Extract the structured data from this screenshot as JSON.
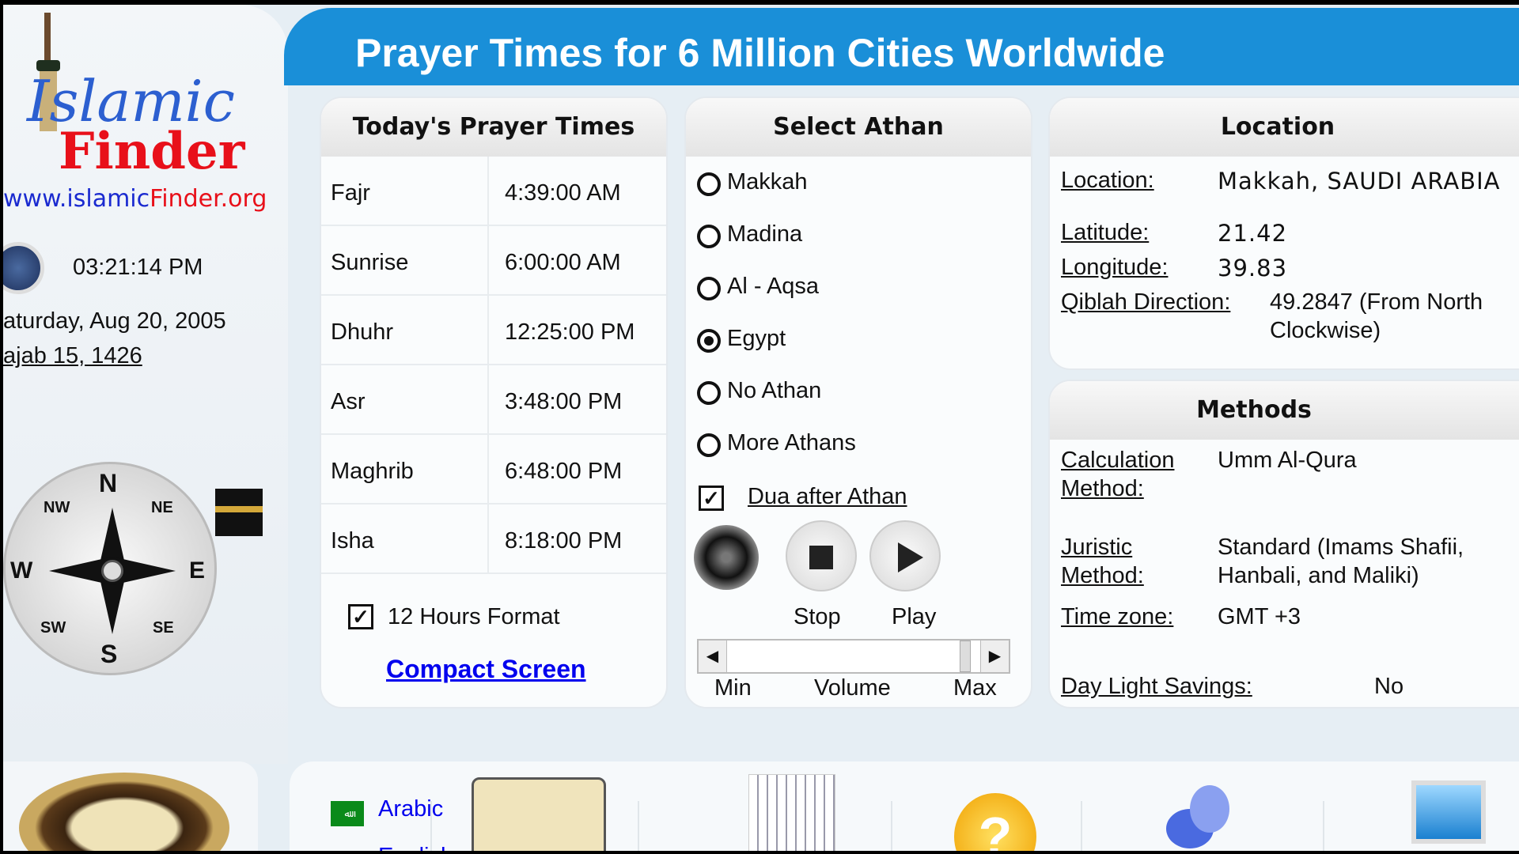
{
  "header": {
    "title": "Prayer Times for 6 Million Cities Worldwide"
  },
  "sidebar": {
    "logo": {
      "line1": "Islamic",
      "line2": "Finder"
    },
    "url_blue": "www.islamic",
    "url_red": "Finder.org",
    "clock_time": "03:21:14 PM",
    "gregorian_date": "aturday, Aug 20, 2005",
    "hijri_date": "ajab 15, 1426",
    "compass": {
      "n": "N",
      "s": "S",
      "e": "E",
      "w": "W",
      "ne": "NE",
      "nw": "NW",
      "se": "SE",
      "sw": "SW"
    }
  },
  "prayer_panel": {
    "title": "Today's Prayer Times",
    "rows": [
      {
        "name": "Fajr",
        "time": "4:39:00 AM"
      },
      {
        "name": "Sunrise",
        "time": "6:00:00 AM"
      },
      {
        "name": "Dhuhr",
        "time": "12:25:00 PM"
      },
      {
        "name": "Asr",
        "time": "3:48:00 PM"
      },
      {
        "name": "Maghrib",
        "time": "6:48:00 PM"
      },
      {
        "name": "Isha",
        "time": "8:18:00 PM"
      }
    ],
    "hours_format_label": "12 Hours Format",
    "hours_format_checked": true,
    "compact_link": "Compact Screen"
  },
  "athan_panel": {
    "title": "Select Athan",
    "options": [
      "Makkah",
      "Madina",
      "Al - Aqsa",
      "Egypt",
      "No Athan",
      "More Athans"
    ],
    "selected": "Egypt",
    "dua_label": "Dua after Athan",
    "dua_checked": true,
    "stop_label": "Stop",
    "play_label": "Play",
    "volume_min": "Min",
    "volume_label": "Volume",
    "volume_max": "Max"
  },
  "location_panel": {
    "title": "Location",
    "location_label": "Location:",
    "location_value": "Makkah, SAUDI ARABIA",
    "latitude_label": "Latitude:",
    "latitude_value": "21.42",
    "longitude_label": "Longitude:",
    "longitude_value": "39.83",
    "qiblah_label": "Qiblah Direction:",
    "qiblah_value1": "49.2847 (From North",
    "qiblah_value2": "Clockwise)"
  },
  "methods_panel": {
    "title": "Methods",
    "calc_label1": "Calculation",
    "calc_label2": "Method:",
    "calc_value": "Umm Al-Qura",
    "juristic_label1": "Juristic",
    "juristic_label2": "Method:",
    "juristic_value1": "Standard (Imams Shafii,",
    "juristic_value2": "Hanbali, and Maliki)",
    "timezone_label": "Time zone:",
    "timezone_value": "GMT +3",
    "dls_label": "Day Light Savings:",
    "dls_value": "No"
  },
  "bottom": {
    "arabic_label": "Arabic",
    "english_label": "English"
  },
  "colors": {
    "header_blue": "#1a8fd8",
    "link_blue": "#0000ee",
    "logo_red": "#e8101a"
  }
}
